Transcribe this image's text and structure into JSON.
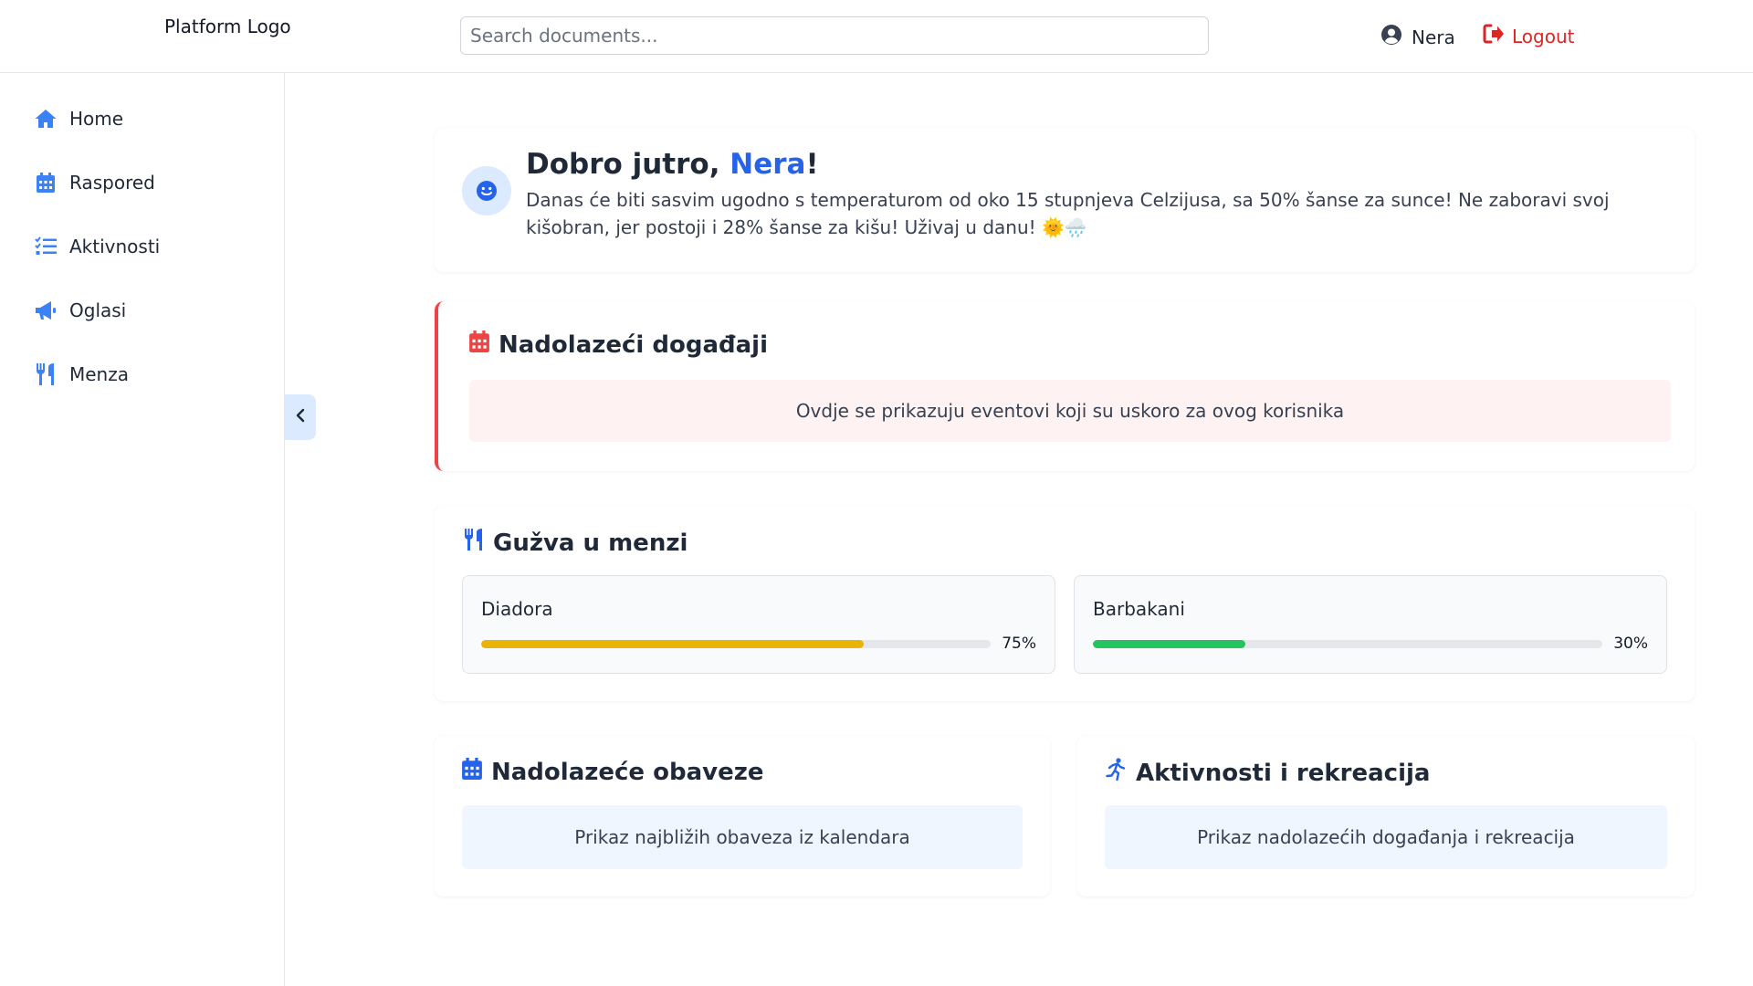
{
  "header": {
    "logo": "Platform Logo",
    "search_placeholder": "Search documents...",
    "user_name": "Nera",
    "logout_label": "Logout"
  },
  "sidebar": {
    "items": [
      {
        "label": "Home",
        "icon": "home-icon"
      },
      {
        "label": "Raspored",
        "icon": "calendar-icon"
      },
      {
        "label": "Aktivnosti",
        "icon": "list-check-icon"
      },
      {
        "label": "Oglasi",
        "icon": "megaphone-icon"
      },
      {
        "label": "Menza",
        "icon": "utensils-icon"
      }
    ],
    "collapse_icon": "chevron-left-icon"
  },
  "greeting": {
    "prefix": "Dobro jutro, ",
    "name": "Nera",
    "suffix": "!",
    "text": "Danas će biti sasvim ugodno s temperaturom od oko 15 stupnjeva Celzijusa, sa 50% šanse za sunce! Ne zaboravi svoj kišobran, jer postoji i 28% šanse za kišu! Uživaj u danu! 🌞🌧️",
    "icon": "smile-icon"
  },
  "events": {
    "title": "Nadolazeći događaji",
    "message": "Ovdje se prikazuju eventovi koji su uskoro za ovog korisnika",
    "accent": "#ef4444"
  },
  "menza": {
    "title": "Gužva u menzi",
    "canteens": [
      {
        "name": "Diadora",
        "percent_label": "75%",
        "level": 0.75,
        "color": "#eab308"
      },
      {
        "name": "Barbakani",
        "percent_label": "30%",
        "level": 0.3,
        "color": "#22c55e"
      }
    ]
  },
  "obaveze": {
    "title": "Nadolazeće obaveze",
    "message": "Prikaz najbližih obaveza iz kalendara"
  },
  "aktivnosti": {
    "title": "Aktivnosti i rekreacija",
    "message": "Prikaz nadolazećih događanja i rekreacija"
  },
  "colors": {
    "accent_blue": "#2563eb",
    "logout_red": "#dc2626"
  }
}
